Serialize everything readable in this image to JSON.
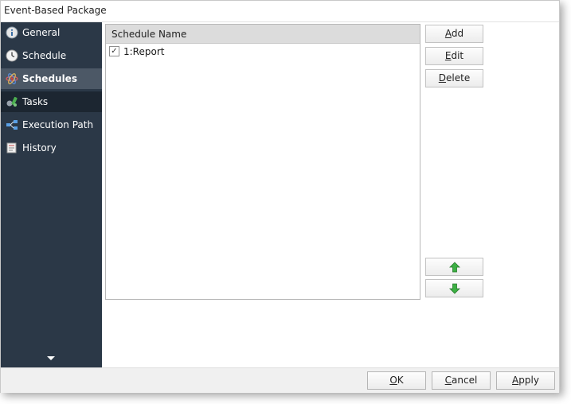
{
  "window": {
    "title": "Event-Based Package"
  },
  "sidebar": {
    "items": [
      {
        "label": "General",
        "icon": "info-icon"
      },
      {
        "label": "Schedule",
        "icon": "clock-icon"
      },
      {
        "label": "Schedules",
        "icon": "atom-icon",
        "selected": true
      },
      {
        "label": "Tasks",
        "icon": "tasks-icon"
      },
      {
        "label": "Execution Path",
        "icon": "flow-icon"
      },
      {
        "label": "History",
        "icon": "history-icon"
      }
    ]
  },
  "grid": {
    "header": "Schedule Name",
    "rows": [
      {
        "checked": true,
        "check_glyph": "✓",
        "name": "1:Report"
      }
    ]
  },
  "side_buttons": {
    "add": {
      "key": "A",
      "rest": "dd"
    },
    "edit": {
      "key": "E",
      "rest": "dit"
    },
    "delete": {
      "key": "D",
      "rest": "elete"
    },
    "move_up_icon": "green-up-arrow-icon",
    "move_down_icon": "green-down-arrow-icon"
  },
  "footer": {
    "ok": {
      "key": "O",
      "rest": "K"
    },
    "cancel": {
      "key": "C",
      "rest": "ancel"
    },
    "apply": {
      "key": "A",
      "rest": "pply"
    }
  },
  "colors": {
    "sidebar_bg": "#2b3847",
    "sidebar_selected": "#4c5866",
    "arrow_green": "#3cb043"
  }
}
